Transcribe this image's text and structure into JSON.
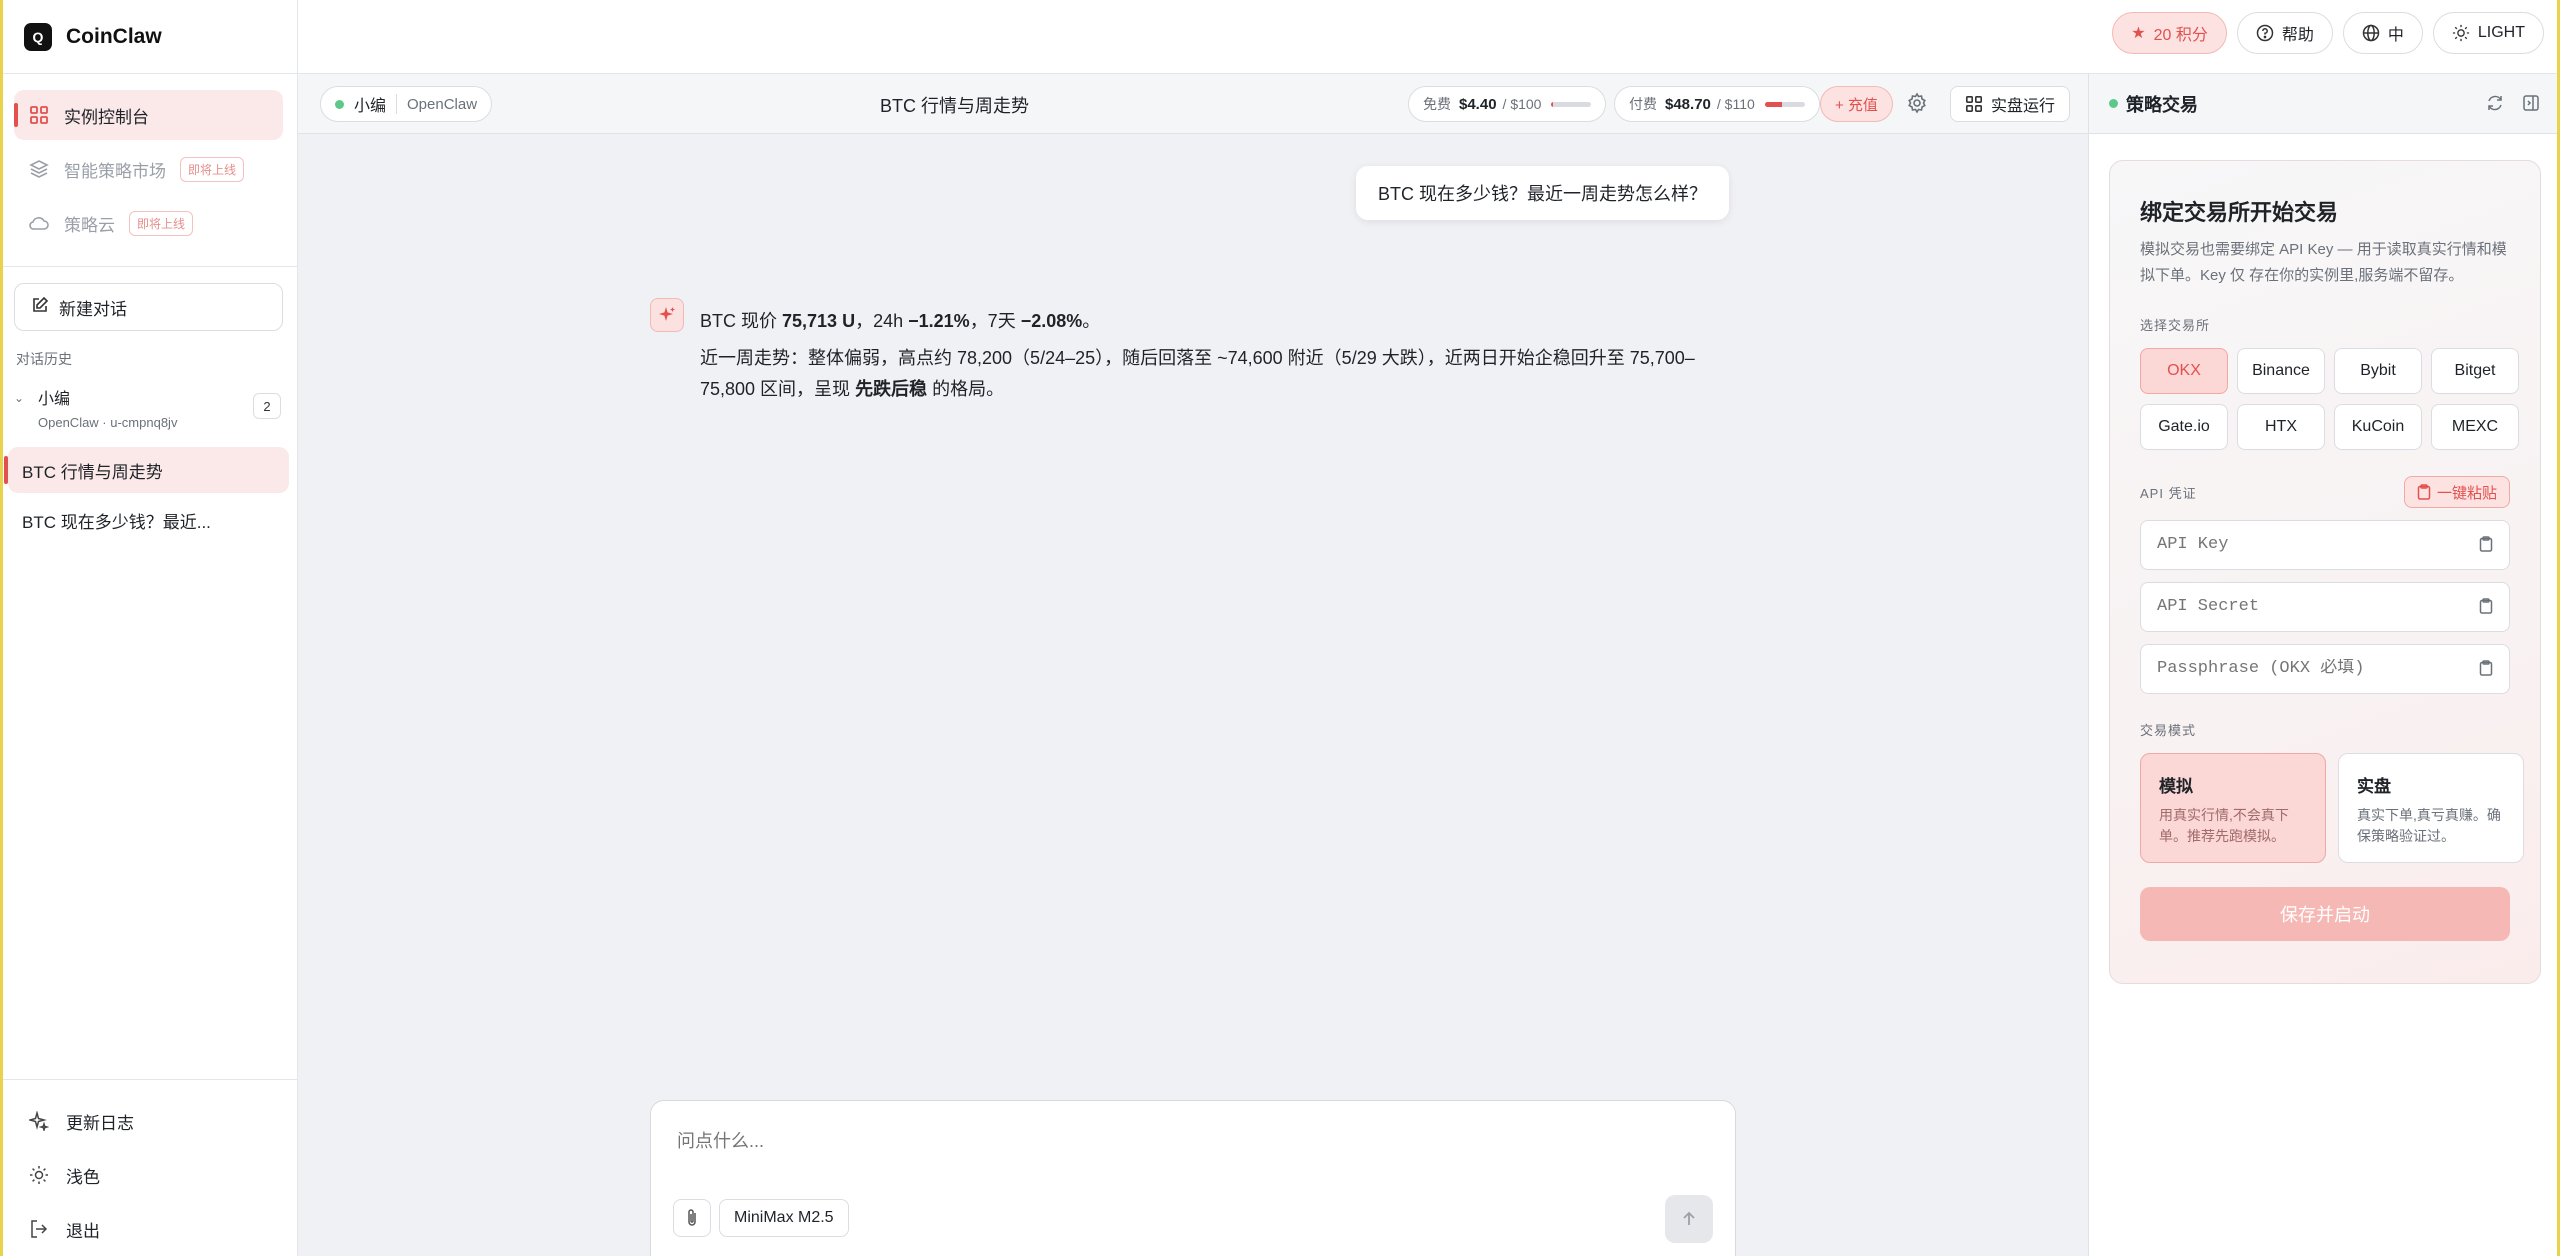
{
  "brand": {
    "logo_text": "Q",
    "name": "CoinClaw"
  },
  "nav": {
    "items": [
      {
        "label": "实例控制台",
        "icon": "grid-icon"
      },
      {
        "label": "智能策略市场",
        "icon": "layers-icon",
        "badge": "即将上线"
      },
      {
        "label": "策略云",
        "icon": "cloud-icon",
        "badge": "即将上线"
      }
    ]
  },
  "new_chat_label": "新建对话",
  "history": {
    "title": "对话历史",
    "group_name": "小编",
    "group_sub": "OpenClaw · u-cmpnq8jv",
    "group_count": "2",
    "items": [
      "BTC 行情与周走势",
      "BTC 现在多少钱？最近..."
    ]
  },
  "sidebar_bottom": [
    "更新日志",
    "浅色",
    "退出"
  ],
  "topbar": {
    "points": "20 积分",
    "help": "帮助",
    "lang": "中",
    "theme": "LIGHT"
  },
  "chat_header": {
    "agent_name": "小编",
    "platform": "OpenClaw",
    "title": "BTC 行情与周走势",
    "free_label": "免费",
    "free_value": "$4.40",
    "free_limit": "/ $100",
    "free_fraction": 0.044,
    "paid_label": "付费",
    "paid_value": "$48.70",
    "paid_limit": "/ $110",
    "paid_fraction": 0.44,
    "recharge": "+ 充值",
    "live_run": "实盘运行"
  },
  "messages": {
    "user": "BTC 现在多少钱？最近一周走势怎么样？",
    "bot": {
      "l1_a": "BTC 现价 ",
      "l1_b": "75,713 U",
      "l1_c": "，24h ",
      "l1_d": "−1.21%",
      "l1_e": "，7天 ",
      "l1_f": "−2.08%",
      "l1_g": "。",
      "l2_a": "近一周走势：整体偏弱，高点约 78,200（5/24–25），随后回落至 ~74,600 附近（5/29 大跌），近两日开始企稳回升至 75,700–75,800 区间，呈现 ",
      "l2_b": "先跌后稳",
      "l2_c": " 的格局。"
    }
  },
  "composer": {
    "placeholder": "问点什么...",
    "model": "MiniMax M2.5"
  },
  "right_panel": {
    "title": "策略交易",
    "card_title": "绑定交易所开始交易",
    "card_desc": "模拟交易也需要绑定 API Key — 用于读取真实行情和模拟下单。Key 仅 存在你的实例里,服务端不留存。",
    "exchange_label": "选择交易所",
    "exchanges": [
      "OKX",
      "Binance",
      "Bybit",
      "Bitget",
      "Gate.io",
      "HTX",
      "KuCoin",
      "MEXC"
    ],
    "selected_exchange": "OKX",
    "cred_label": "API 凭证",
    "paste_label": "一键粘贴",
    "api_key_placeholder": "API Key",
    "api_secret_placeholder": "API Secret",
    "passphrase_placeholder": "Passphrase (OKX 必填)",
    "mode_label": "交易模式",
    "modes": [
      {
        "title": "模拟",
        "desc": "用真实行情,不会真下单。推荐先跑模拟。"
      },
      {
        "title": "实盘",
        "desc": "真实下单,真亏真赚。确保策略验证过。"
      }
    ],
    "save_label": "保存并启动"
  },
  "colors": {
    "accent": "#e2514e",
    "accent_soft": "#fce3e2",
    "online": "#5cc98a"
  }
}
